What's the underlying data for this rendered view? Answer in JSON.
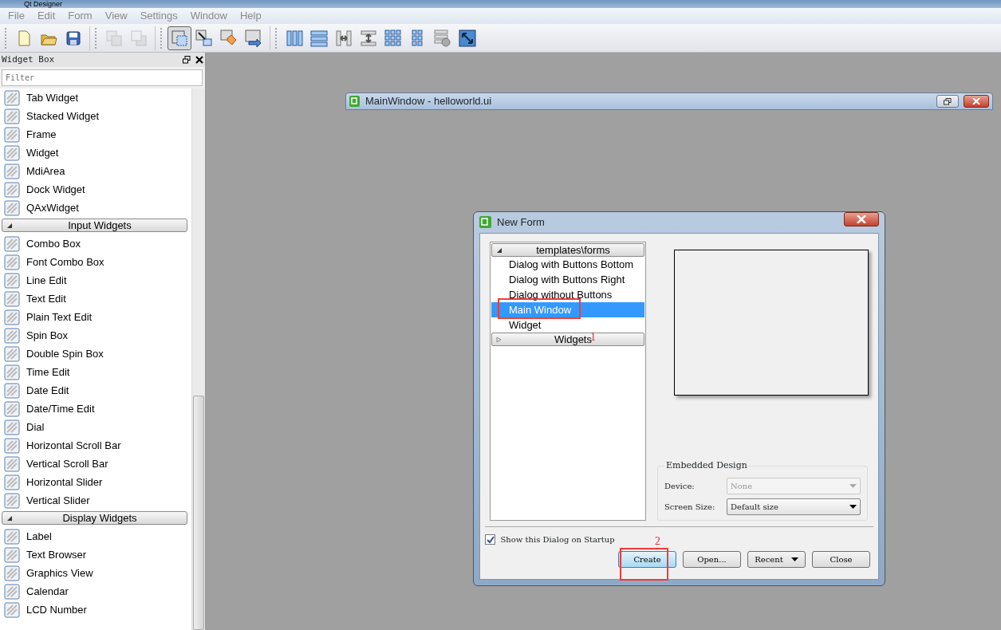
{
  "window": {
    "title": "Qt Designer"
  },
  "menu": [
    "File",
    "Edit",
    "Form",
    "View",
    "Settings",
    "Window",
    "Help"
  ],
  "toolbar": {
    "groups": [
      [
        {
          "kind": "new",
          "selected": false,
          "disabled": false
        },
        {
          "kind": "open",
          "selected": false,
          "disabled": false
        },
        {
          "kind": "save",
          "selected": false,
          "disabled": false
        }
      ],
      [
        {
          "kind": "front",
          "selected": false,
          "disabled": true
        },
        {
          "kind": "back",
          "selected": false,
          "disabled": true
        }
      ],
      [
        {
          "kind": "widgets",
          "selected": true,
          "disabled": false
        },
        {
          "kind": "signals",
          "selected": false,
          "disabled": false
        },
        {
          "kind": "buddies",
          "selected": false,
          "disabled": false
        },
        {
          "kind": "taborder",
          "selected": false,
          "disabled": false
        }
      ],
      [
        {
          "kind": "hlayout",
          "selected": false,
          "disabled": false
        },
        {
          "kind": "vlayout",
          "selected": false,
          "disabled": false
        },
        {
          "kind": "hsplit",
          "selected": false,
          "disabled": false
        },
        {
          "kind": "vsplit",
          "selected": false,
          "disabled": false
        },
        {
          "kind": "grid",
          "selected": false,
          "disabled": false
        },
        {
          "kind": "formgrid",
          "selected": false,
          "disabled": false
        },
        {
          "kind": "break",
          "selected": false,
          "disabled": false
        },
        {
          "kind": "adjust",
          "selected": false,
          "disabled": false
        }
      ]
    ]
  },
  "widget_box": {
    "title": "Widget Box",
    "filter": {
      "placeholder": "Filter"
    },
    "items": [
      {
        "kind": "item",
        "label": "Tab Widget"
      },
      {
        "kind": "item",
        "label": "Stacked Widget"
      },
      {
        "kind": "item",
        "label": "Frame"
      },
      {
        "kind": "item",
        "label": "Widget"
      },
      {
        "kind": "item",
        "label": "MdiArea"
      },
      {
        "kind": "item",
        "label": "Dock Widget"
      },
      {
        "kind": "item",
        "label": "QAxWidget"
      },
      {
        "kind": "category",
        "label": "Input Widgets",
        "expanded": true
      },
      {
        "kind": "item",
        "label": "Combo Box"
      },
      {
        "kind": "item",
        "label": "Font Combo Box"
      },
      {
        "kind": "item",
        "label": "Line Edit"
      },
      {
        "kind": "item",
        "label": "Text Edit"
      },
      {
        "kind": "item",
        "label": "Plain Text Edit"
      },
      {
        "kind": "item",
        "label": "Spin Box"
      },
      {
        "kind": "item",
        "label": "Double Spin Box"
      },
      {
        "kind": "item",
        "label": "Time Edit"
      },
      {
        "kind": "item",
        "label": "Date Edit"
      },
      {
        "kind": "item",
        "label": "Date/Time Edit"
      },
      {
        "kind": "item",
        "label": "Dial"
      },
      {
        "kind": "item",
        "label": "Horizontal Scroll Bar"
      },
      {
        "kind": "item",
        "label": "Vertical Scroll Bar"
      },
      {
        "kind": "item",
        "label": "Horizontal Slider"
      },
      {
        "kind": "item",
        "label": "Vertical Slider"
      },
      {
        "kind": "category",
        "label": "Display Widgets",
        "expanded": true
      },
      {
        "kind": "item",
        "label": "Label"
      },
      {
        "kind": "item",
        "label": "Text Browser"
      },
      {
        "kind": "item",
        "label": "Graphics View"
      },
      {
        "kind": "item",
        "label": "Calendar"
      },
      {
        "kind": "item",
        "label": "LCD Number"
      }
    ]
  },
  "subwindow": {
    "title": "MainWindow - helloworld.ui"
  },
  "dialog": {
    "title": "New Form",
    "tree": [
      {
        "label": "templates\\forms",
        "expanded": true,
        "children": [
          {
            "label": "Dialog with Buttons Bottom",
            "selected": false
          },
          {
            "label": "Dialog with Buttons Right",
            "selected": false
          },
          {
            "label": "Dialog without Buttons",
            "selected": false
          },
          {
            "label": "Main Window",
            "selected": true
          },
          {
            "label": "Widget",
            "selected": false
          }
        ]
      },
      {
        "label": "Widgets",
        "expanded": false
      }
    ],
    "embedded_design": {
      "title": "Embedded Design",
      "fields": [
        {
          "label": "Device:",
          "value": "None",
          "disabled": true
        },
        {
          "label": "Screen Size:",
          "value": "Default size",
          "disabled": false
        }
      ]
    },
    "show_on_startup": {
      "label": "Show this Dialog on Startup",
      "checked": true
    },
    "buttons": [
      {
        "label": "Create",
        "kind": "default"
      },
      {
        "label": "Open...",
        "kind": "plain"
      },
      {
        "label": "Recent",
        "kind": "menu"
      },
      {
        "label": "Close",
        "kind": "plain"
      }
    ]
  },
  "annotations": [
    {
      "label": "1"
    },
    {
      "label": "2"
    }
  ]
}
